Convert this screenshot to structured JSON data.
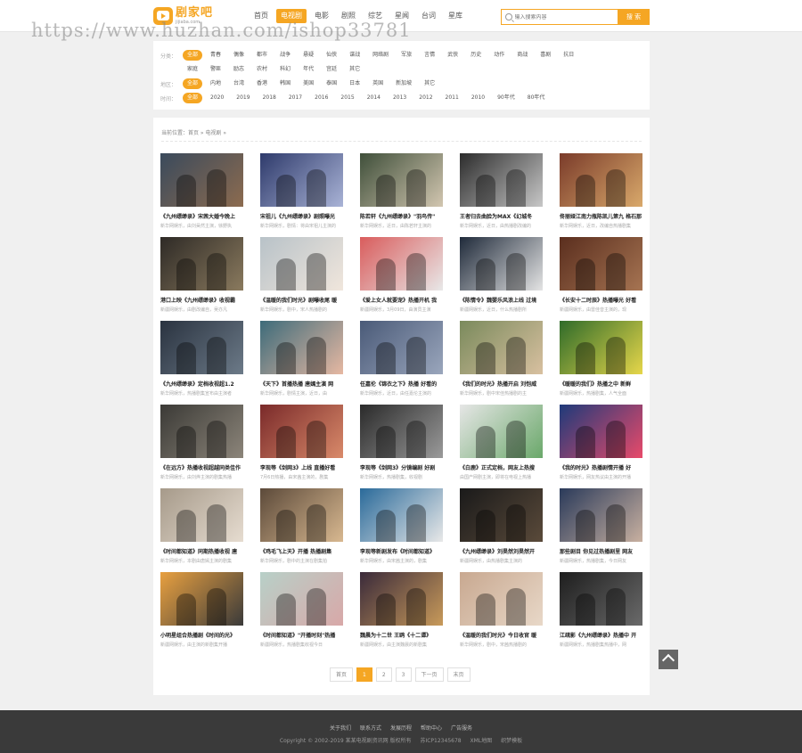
{
  "header": {
    "logo_name": "剧家吧",
    "logo_sub": "jijiaba.com",
    "nav": [
      {
        "label": "首页",
        "active": false
      },
      {
        "label": "电视剧",
        "active": true
      },
      {
        "label": "电影",
        "active": false
      },
      {
        "label": "剧照",
        "active": false
      },
      {
        "label": "综艺",
        "active": false
      },
      {
        "label": "星闻",
        "active": false
      },
      {
        "label": "台词",
        "active": false
      },
      {
        "label": "星库",
        "active": false
      }
    ],
    "search_placeholder": "输入搜索内容",
    "search_button": "搜 索"
  },
  "watermark": "https://www.huzhan.com/ishop33781",
  "filters": {
    "type_label": "分类：",
    "types_row1": [
      "全部",
      "青春",
      "偶像",
      "都市",
      "战争",
      "悬疑",
      "仙侠",
      "谍战",
      "网络剧",
      "军旅",
      "言情",
      "武侠",
      "历史",
      "动作",
      "商战",
      "喜剧",
      "抗日"
    ],
    "types_row2": [
      "家庭",
      "警匪",
      "励志",
      "农村",
      "科幻",
      "年代",
      "宫廷",
      "其它"
    ],
    "region_label": "地区：",
    "regions": [
      "全部",
      "内地",
      "台湾",
      "香港",
      "韩国",
      "美国",
      "泰国",
      "日本",
      "英国",
      "新加坡",
      "其它"
    ],
    "time_label": "时间：",
    "times": [
      "全部",
      "2020",
      "2019",
      "2018",
      "2017",
      "2016",
      "2015",
      "2014",
      "2013",
      "2012",
      "2011",
      "2010",
      "90年代",
      "80年代"
    ]
  },
  "breadcrumb": "当前位置：首页 » 电视剧 »",
  "cards": [
    {
      "title": "《九州缥缈录》宋茜大婚今晚上",
      "desc": "新华网娱乐，由刘昊然主演，徐野执",
      "color1": "#3a4a5c",
      "color2": "#8c6b4f"
    },
    {
      "title": "宋祖儿《九州缥缈录》剧照曝光",
      "desc": "新华网娱乐，剧情：将由宋祖儿主演的",
      "color1": "#2e3a6b",
      "color2": "#a9b3d6"
    },
    {
      "title": "陈若轩《九州缥缈录》\"羽鸟传\"",
      "desc": "新华网娱乐，近日，由陈若轩主演的",
      "color1": "#3f4f3a",
      "color2": "#d2c6b0"
    },
    {
      "title": "王者归去曲脸为MAX《幻城冬",
      "desc": "新华网娱乐，近日，由热播剧改编的",
      "color1": "#2c2c2c",
      "color2": "#c7c7c7"
    },
    {
      "title": "佟丽娅江南力瓶陈凯儿第九 格石那",
      "desc": "新华网娱乐，近日，改编自热播剧集",
      "color1": "#7a3b2a",
      "color2": "#d9a96b"
    },
    {
      "title": "港口上映《九州缥缈录》收视霸",
      "desc": "新疆网娱乐，由剧改编自，吴亦凡",
      "color1": "#2e2a26",
      "color2": "#8a7a5e"
    },
    {
      "title": "《温暖的我们时光》剧曝收尾 暖",
      "desc": "新华网娱乐，剧中，宋人热播剧的",
      "color1": "#b8c2c8",
      "color2": "#f0e6dc"
    },
    {
      "title": "《爱上女人就要宠》热播开机 我",
      "desc": "新疆网娱乐，3月09日，由演员主演",
      "color1": "#d95c5c",
      "color2": "#e8e8e8"
    },
    {
      "title": "《陈情令》魏婴乐风浪上线 过境",
      "desc": "新疆网娱乐，近日，什么热播剧所",
      "color1": "#1f2a3a",
      "color2": "#e4e4e4"
    },
    {
      "title": "《长安十二时辰》热播曝光 好看",
      "desc": "新疆网娱乐，由雷佳音主演的，现",
      "color1": "#5a2e1e",
      "color2": "#a67452"
    },
    {
      "title": "《九州缥缈录》定档收视超1.2",
      "desc": "新华网娱乐，热播剧集宣布由主演者",
      "color1": "#2a3340",
      "color2": "#6c7a88"
    },
    {
      "title": "《天下》首播热播 唐嫣主演 网",
      "desc": "新华网娱乐，剧情主演，近日，由",
      "color1": "#3d6b7a",
      "color2": "#e6b8a2"
    },
    {
      "title": "任嘉伦《锦衣之下》热播 好看的",
      "desc": "新华网娱乐，近日，由任嘉伦主演的",
      "color1": "#4a5a78",
      "color2": "#9aa6bc"
    },
    {
      "title": "《我们的时光》热播开启 刘恺威",
      "desc": "新华网娱乐，剧中宋佳热播剧的主",
      "color1": "#7a8a5c",
      "color2": "#d8c0a0"
    },
    {
      "title": "《暖暖的我们》热播之中 新鲜",
      "desc": "新疆网娱乐，热播剧集，人气全面",
      "color1": "#2f6b2a",
      "color2": "#e6d64a"
    },
    {
      "title": "《在远方》热播收视超越同类佳作",
      "desc": "新华网娱乐，由刘烨主演的剧集热播",
      "color1": "#3b3a36",
      "color2": "#8c857a"
    },
    {
      "title": "李现等《剑网3》上线 直播好看",
      "desc": "7月6日热播，由宋茜主演的，剧集",
      "color1": "#7a2a2a",
      "color2": "#d98a6a"
    },
    {
      "title": "李现等《剑网3》分镜编剧 好剧",
      "desc": "新华网娱乐，热播剧集，收视剧",
      "color1": "#2a2a2a",
      "color2": "#9a9a9a"
    },
    {
      "title": "《白鹿》正式定档，网友上热搜",
      "desc": "由国产网剧主演，即将在电视上热播",
      "color1": "#e6e6e6",
      "color2": "#6aa86a"
    },
    {
      "title": "《我的时光》热播剧情开播 好",
      "desc": "新华网娱乐，网友热议由主演的开播",
      "color1": "#1e3a7a",
      "color2": "#e84a6a"
    },
    {
      "title": "《时间都知道》同期热播收视 唐",
      "desc": "新华网娱乐，本剧由唐嫣主演的剧集",
      "color1": "#a69a8a",
      "color2": "#e6dcd0"
    },
    {
      "title": "《鸡毛飞上天》开播 热播剧集",
      "desc": "新华网娱乐，剧中的主演在剧集拍",
      "color1": "#5c4a3a",
      "color2": "#d8b890"
    },
    {
      "title": "李现等新剧发布《时间都知道》",
      "desc": "新华网娱乐，由宋茜主演的，剧集",
      "color1": "#2a6a9a",
      "color2": "#e8e8e8"
    },
    {
      "title": "《九州缥缈录》刘昊然刘昊然开",
      "desc": "新疆网娱乐，由热播剧集主演的",
      "color1": "#1a1a1a",
      "color2": "#5a4a3a"
    },
    {
      "title": "那些剧目 你见过热播剧里 网友",
      "desc": "新疆网娱乐，热播剧集，今日网友",
      "color1": "#2a3a5a",
      "color2": "#c8b0a0"
    },
    {
      "title": "小明星组合热播剧《时间的光》",
      "desc": "新疆网娱乐，由主演的新剧集开播",
      "color1": "#e8a040",
      "color2": "#3a3a3a"
    },
    {
      "title": "《时间都知道》\"开播时刻\"热播",
      "desc": "新疆网娱乐，热播剧集收视今日",
      "color1": "#b8d0c8",
      "color2": "#d8a8a8"
    },
    {
      "title": "魏晨为十二世 王鸥《十二谭》",
      "desc": "新疆网娱乐，由主演魏晨的新剧集",
      "color1": "#3a2a3a",
      "color2": "#c89a5a"
    },
    {
      "title": "《温暖的我们时光》今日收官 暖",
      "desc": "新华网娱乐，剧中，宋茜热播剧的",
      "color1": "#c8a890",
      "color2": "#e8d8c8"
    },
    {
      "title": "江疏影《九州缥缈录》热播中 开",
      "desc": "新疆网娱乐，热播剧集热播中，网",
      "color1": "#1e1e1e",
      "color2": "#6a6a6a"
    }
  ],
  "pager": {
    "prev": "首页",
    "pages": [
      "1",
      "2",
      "3"
    ],
    "active_page": "1",
    "next": "下一页",
    "last": "末页"
  },
  "footer": {
    "links": [
      "关于我们",
      "联系方式",
      "发展历程",
      "帮助中心",
      "广告服务"
    ],
    "copyright": "Copyright © 2002-2019 某某电视剧资讯网 版权所有",
    "icp": "苏ICP12345678",
    "sitemap": "XML地图",
    "template": "织梦模板"
  },
  "colors": {
    "accent": "#f5a623",
    "footer_bg": "#3a3a3a"
  }
}
